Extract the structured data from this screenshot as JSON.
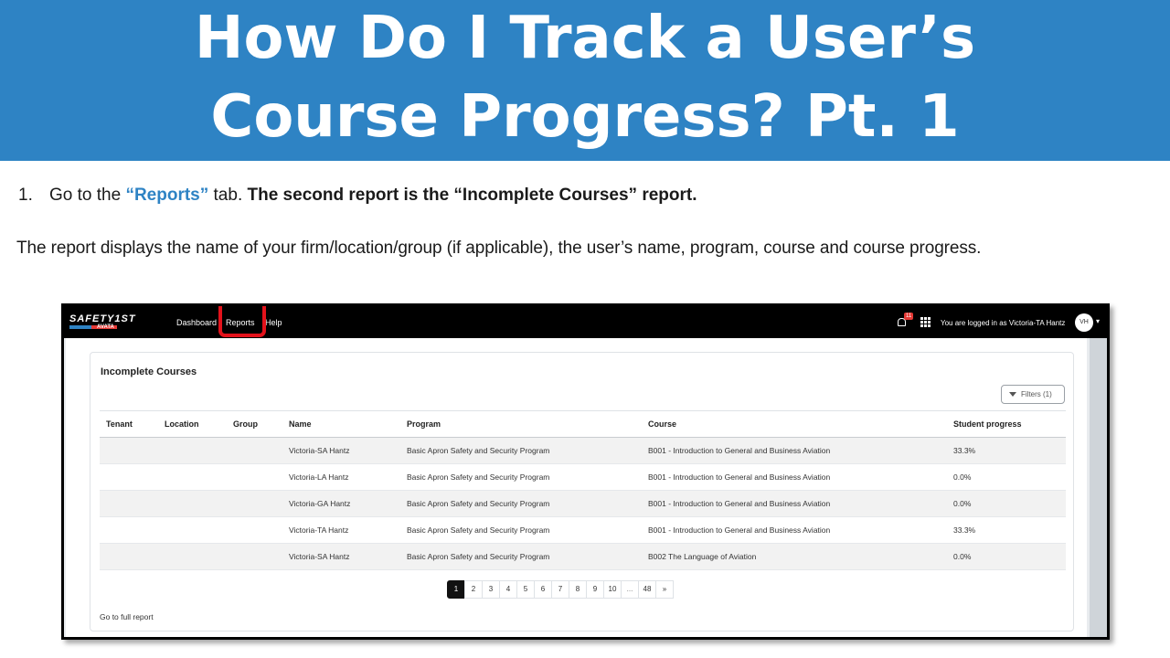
{
  "slide": {
    "title_line1": "How Do I Track a User’s",
    "title_line2": "Course Progress? Pt. 1",
    "step_number": "1.",
    "step_pre": "Go to the ",
    "step_highlight": "“Reports”",
    "step_mid": " tab. ",
    "step_bold": "The second report is the “Incomplete Courses” report.",
    "description": "The report displays the name of your firm/location/group (if applicable), the user’s name, program, course and course progress."
  },
  "app": {
    "logo_text": "SAFETY1ST",
    "logo_sub": "AVATA",
    "nav": {
      "dashboard": "Dashboard",
      "reports": "Reports",
      "help": "Help"
    },
    "notification_count": "11",
    "logged_in_text": "You are logged in as Victoria-TA Hantz",
    "avatar_initials": "VH",
    "accent_color": "#2e83c4",
    "highlight_color": "#e3121b"
  },
  "report": {
    "title": "Incomplete Courses",
    "filters_label": "Filters (1)",
    "columns": [
      "Tenant",
      "Location",
      "Group",
      "Name",
      "Program",
      "Course",
      "Student progress"
    ],
    "rows": [
      [
        "",
        "",
        "",
        "Victoria-SA Hantz",
        "Basic Apron Safety and Security Program",
        "B001 - Introduction to General and Business Aviation",
        "33.3%"
      ],
      [
        "",
        "",
        "",
        "Victoria-LA Hantz",
        "Basic Apron Safety and Security Program",
        "B001 - Introduction to General and Business Aviation",
        "0.0%"
      ],
      [
        "",
        "",
        "",
        "Victoria-GA Hantz",
        "Basic Apron Safety and Security Program",
        "B001 - Introduction to General and Business Aviation",
        "0.0%"
      ],
      [
        "",
        "",
        "",
        "Victoria-TA Hantz",
        "Basic Apron Safety and Security Program",
        "B001 - Introduction to General and Business Aviation",
        "33.3%"
      ],
      [
        "",
        "",
        "",
        "Victoria-SA Hantz",
        "Basic Apron Safety and Security Program",
        "B002 The Language of Aviation",
        "0.0%"
      ]
    ],
    "pagination": [
      "1",
      "2",
      "3",
      "4",
      "5",
      "6",
      "7",
      "8",
      "9",
      "10",
      "...",
      "48",
      "»"
    ],
    "full_report_link": "Go to full report"
  }
}
